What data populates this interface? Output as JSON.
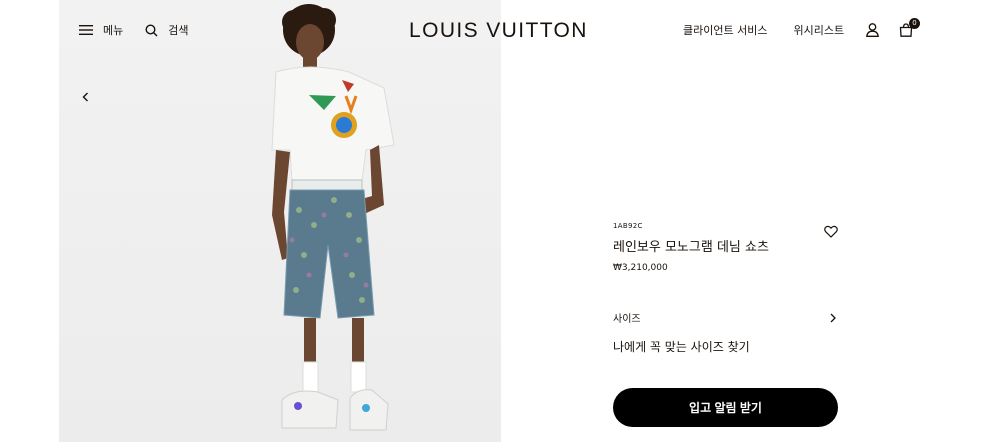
{
  "header": {
    "menu_label": "메뉴",
    "search_label": "검색",
    "logo_text": "LOUIS VUITTON",
    "client_service_label": "클라이언트 서비스",
    "wishlist_label": "위시리스트",
    "cart_count": "0"
  },
  "product": {
    "sku": "1AB92C",
    "name": "레인보우 모노그램 데님 쇼츠",
    "price": "₩3,210,000",
    "size_label": "사이즈",
    "find_size_label": "나에게 꼭 맞는 사이즈 찾기",
    "cta_label": "입고 알림 받기"
  },
  "icons": {
    "menu": "hamburger-icon",
    "search": "search-icon",
    "account": "user-icon",
    "cart": "shopping-bag-icon",
    "wishlist": "heart-icon",
    "gallery_prev": "chevron-left-icon",
    "size_arrow": "chevron-right-icon"
  },
  "colors": {
    "brand_dark": "#19110b",
    "cta_background": "#000000",
    "gallery_background": "#efefef"
  }
}
